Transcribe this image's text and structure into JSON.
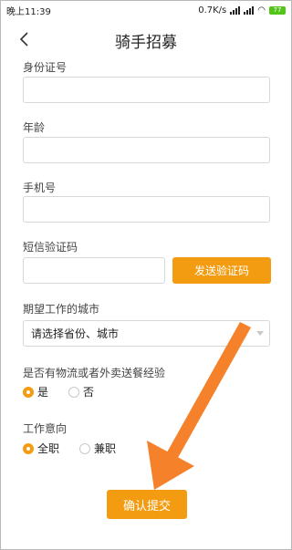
{
  "status_bar": {
    "time": "晚上11:39",
    "network_speed": "0.7K/s",
    "battery": "77"
  },
  "header": {
    "title": "骑手招募"
  },
  "form": {
    "id_number_label": "身份证号",
    "age_label": "年龄",
    "phone_label": "手机号",
    "sms_code_label": "短信验证码",
    "send_code_button": "发送验证码",
    "city_label": "期望工作的城市",
    "city_placeholder": "请选择省份、城市",
    "experience_label": "是否有物流或者外卖送餐经验",
    "experience_yes": "是",
    "experience_no": "否",
    "experience_selected": "是",
    "intent_label": "工作意向",
    "intent_fulltime": "全职",
    "intent_parttime": "兼职",
    "intent_selected": "全职",
    "submit_button": "确认提交"
  },
  "colors": {
    "accent": "#f39c12",
    "annotation_arrow": "#f5822a"
  }
}
